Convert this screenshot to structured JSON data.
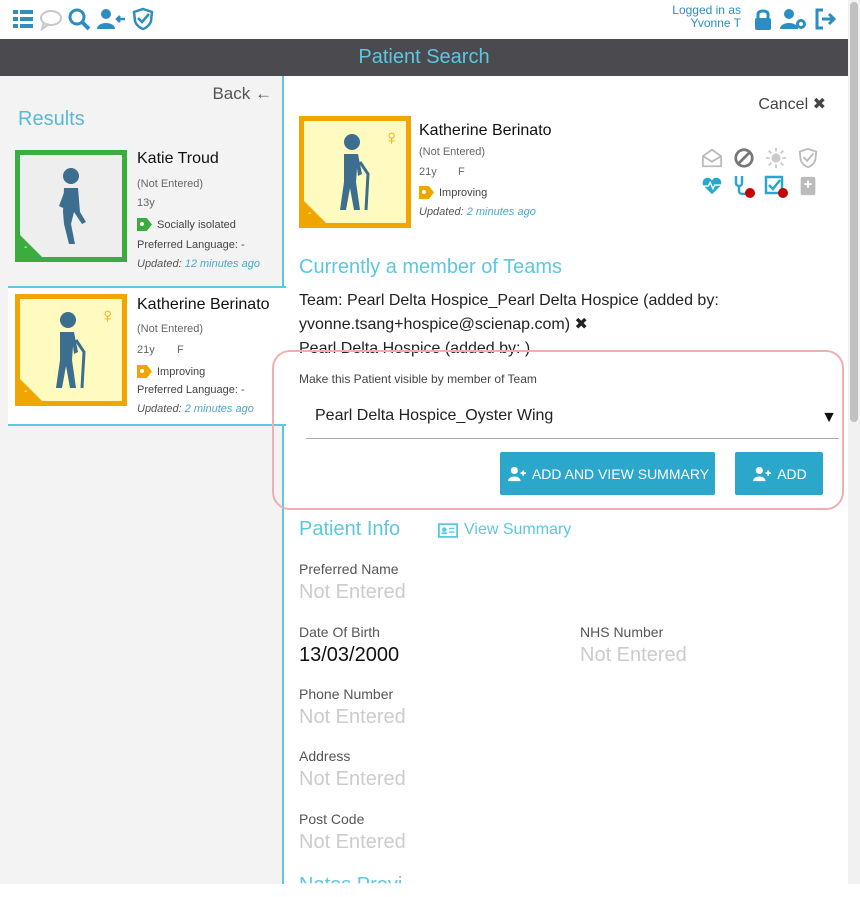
{
  "header": {
    "logged_in_label": "Logged in as",
    "user_name": "Yvonne T",
    "title": "Patient Search",
    "accent": "#2a8fc0",
    "title_color": "#5bc8e0"
  },
  "sidebar": {
    "back_label": "Back",
    "results_title": "Results",
    "patients": [
      {
        "name": "Katie Troud",
        "subtitle": "(Not Entered)",
        "age": "13y",
        "gender": "",
        "status": "Socially isolated",
        "status_color": "#3aad3e",
        "language_label": "Preferred Language:",
        "language": "-",
        "updated_label": "Updated:",
        "updated": "12 minutes ago",
        "border_color": "#3aad3e",
        "icon": "person-walking-icon"
      },
      {
        "name": "Katherine Berinato",
        "subtitle": "(Not Entered)",
        "age": "21y",
        "gender": "F",
        "status": "Improving",
        "status_color": "#f0a500",
        "language_label": "Preferred Language:",
        "language": "-",
        "updated_label": "Updated:",
        "updated": "2 minutes ago",
        "border_color": "#f0a500",
        "icon": "elderly-person-icon"
      }
    ]
  },
  "main": {
    "cancel_label": "Cancel",
    "patient": {
      "name": "Katherine Berinato",
      "subtitle": "(Not Entered)",
      "age": "21y",
      "gender": "F",
      "status": "Improving",
      "updated_label": "Updated:",
      "updated": "2 minutes ago"
    },
    "teams_title": "Currently a member of Teams",
    "team_line1": "Team: Pearl Delta Hospice_Pearl Delta Hospice (added by:",
    "team_line2": "yvonne.tsang+hospice@scienap.com)",
    "team_line3": "Pearl Delta Hospice (added by: )",
    "select_label": "Make this Patient visible by member of Team",
    "select_value": "Pearl Delta Hospice_Oyster Wing",
    "add_view_label": "ADD AND VIEW SUMMARY",
    "add_label": "ADD",
    "info_title": "Patient Info",
    "view_summary_label": "View Summary",
    "fields": {
      "preferred_name_label": "Preferred Name",
      "preferred_name": "Not Entered",
      "dob_label": "Date Of Birth",
      "dob": "13/03/2000",
      "nhs_label": "NHS Number",
      "nhs": "Not Entered",
      "phone_label": "Phone Number",
      "phone": "Not Entered",
      "address_label": "Address",
      "address": "Not Entered",
      "postcode_label": "Post Code",
      "postcode": "Not Entered",
      "next_section_partial": "Notes Previ"
    }
  }
}
